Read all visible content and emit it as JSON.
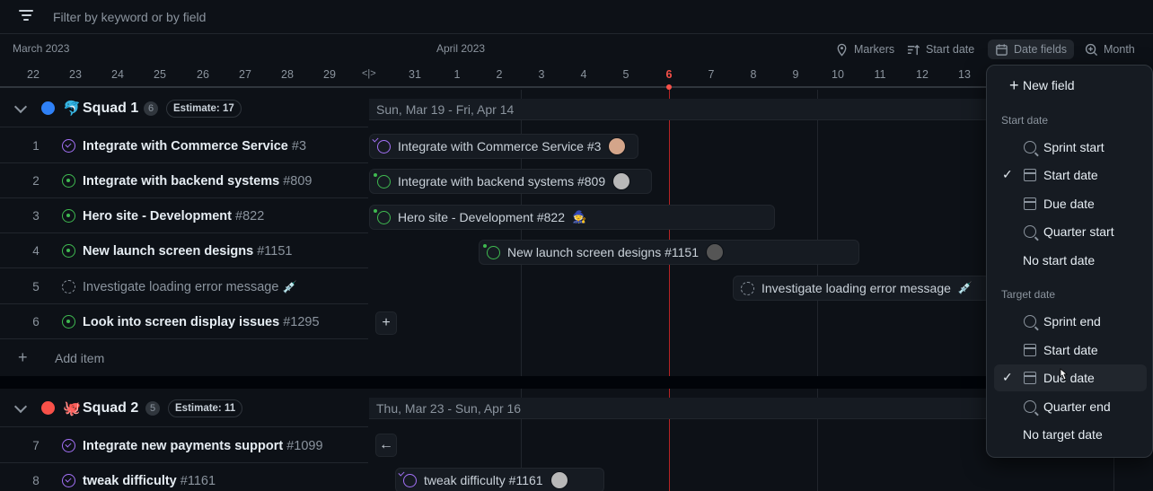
{
  "filter": {
    "placeholder": "Filter by keyword or by field"
  },
  "timeline": {
    "months": [
      "March 2023",
      "April 2023"
    ],
    "toolbar": {
      "markers": "Markers",
      "start_date": "Start date",
      "date_fields": "Date fields",
      "month": "Month"
    },
    "days": [
      "22",
      "23",
      "24",
      "25",
      "26",
      "27",
      "28",
      "29",
      "31",
      "1",
      "2",
      "3",
      "4",
      "5",
      "6",
      "7",
      "8",
      "9",
      "10",
      "11",
      "12",
      "13"
    ],
    "today": "6"
  },
  "groups": [
    {
      "name": "Squad 1",
      "emoji": "🐬",
      "color": "#2f81f7",
      "count": "6",
      "estimate": "Estimate: 17",
      "range": "Sun, Mar 19 - Fri, Apr 14",
      "items": [
        {
          "num": "1",
          "title": "Integrate with Commerce Service",
          "ref": "#3",
          "status": "done",
          "bar_label": "Integrate with Commerce Service #3"
        },
        {
          "num": "2",
          "title": "Integrate with backend systems",
          "ref": "#809",
          "status": "open",
          "bar_label": "Integrate with backend systems #809"
        },
        {
          "num": "3",
          "title": "Hero site - Development",
          "ref": "#822",
          "status": "open",
          "bar_label": "Hero site - Development #822"
        },
        {
          "num": "4",
          "title": "New launch screen designs",
          "ref": "#1151",
          "status": "open",
          "bar_label": "New launch screen designs #1151"
        },
        {
          "num": "5",
          "title": "Investigate loading error message",
          "ref": "",
          "status": "draft",
          "bar_label": "Investigate loading error message"
        },
        {
          "num": "6",
          "title": "Look into screen display issues",
          "ref": "#1295",
          "status": "open",
          "bar_label": ""
        }
      ],
      "add_item": "Add item"
    },
    {
      "name": "Squad 2",
      "emoji": "🐙",
      "color": "#f85149",
      "count": "5",
      "estimate": "Estimate: 11",
      "range": "Thu, Mar 23 - Sun, Apr 16",
      "items": [
        {
          "num": "7",
          "title": "Integrate new payments support",
          "ref": "#1099",
          "status": "done",
          "bar_label": ""
        },
        {
          "num": "8",
          "title": "tweak difficulty",
          "ref": "#1161",
          "status": "done",
          "bar_label": "tweak difficulty #1161"
        }
      ]
    }
  ],
  "date_fields_menu": {
    "new_field": "New field",
    "start_header": "Start date",
    "start_options": [
      {
        "label": "Sprint start",
        "icon": "iteration-icon",
        "checked": false
      },
      {
        "label": "Start date",
        "icon": "calendar-icon",
        "checked": true
      },
      {
        "label": "Due date",
        "icon": "calendar-icon",
        "checked": false
      },
      {
        "label": "Quarter start",
        "icon": "iteration-icon",
        "checked": false
      },
      {
        "label": "No start date",
        "icon": "",
        "checked": false
      }
    ],
    "target_header": "Target date",
    "target_options": [
      {
        "label": "Sprint end",
        "icon": "iteration-icon",
        "checked": false
      },
      {
        "label": "Start date",
        "icon": "calendar-icon",
        "checked": false
      },
      {
        "label": "Due date",
        "icon": "calendar-icon",
        "checked": true
      },
      {
        "label": "Quarter end",
        "icon": "iteration-icon",
        "checked": false
      },
      {
        "label": "No target date",
        "icon": "",
        "checked": false
      }
    ]
  },
  "colors": {
    "today": "#f85149",
    "open": "#3fb950",
    "done": "#a371f7"
  }
}
